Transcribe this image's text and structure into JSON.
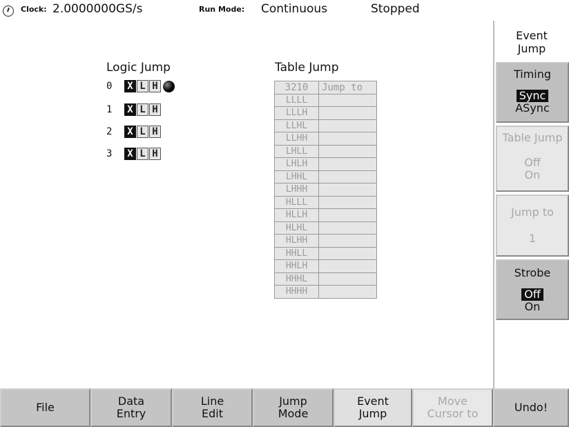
{
  "status": {
    "clock_icon": "clock-icon",
    "clock_label": "Clock:",
    "clock_value": "2.0000000GS/s",
    "run_mode_label": "Run Mode:",
    "run_mode_value": "Continuous",
    "state": "Stopped"
  },
  "logic_jump": {
    "title": "Logic Jump",
    "rows": [
      {
        "index": "0",
        "x": "X",
        "l": "L",
        "h": "H",
        "selected": "X"
      },
      {
        "index": "1",
        "x": "X",
        "l": "L",
        "h": "H",
        "selected": "X"
      },
      {
        "index": "2",
        "x": "X",
        "l": "L",
        "h": "H",
        "selected": "X"
      },
      {
        "index": "3",
        "x": "X",
        "l": "L",
        "h": "H",
        "selected": "X"
      }
    ]
  },
  "table_jump": {
    "title": "Table Jump",
    "header": [
      "3210",
      "Jump to"
    ],
    "rows": [
      "LLLL",
      "LLLH",
      "LLHL",
      "LLHH",
      "LHLL",
      "LHLH",
      "LHHL",
      "LHHH",
      "HLLL",
      "HLLH",
      "HLHL",
      "HLHH",
      "HHLL",
      "HHLH",
      "HHHL",
      "HHHH"
    ]
  },
  "side_menu": {
    "title_line1": "Event",
    "title_line2": "Jump",
    "timing": {
      "label": "Timing",
      "opt1": "Sync",
      "opt2": "ASync"
    },
    "table_jump": {
      "label": "Table Jump",
      "opt1": "Off",
      "opt2": "On"
    },
    "jump_to": {
      "label": "Jump to",
      "value": "1"
    },
    "strobe": {
      "label": "Strobe",
      "opt1": "Off",
      "opt2": "On"
    }
  },
  "bottom_menu": {
    "file": "File",
    "data_entry_1": "Data",
    "data_entry_2": "Entry",
    "line_edit_1": "Line",
    "line_edit_2": "Edit",
    "jump_mode_1": "Jump",
    "jump_mode_2": "Mode",
    "event_jump_1": "Event",
    "event_jump_2": "Jump",
    "move_cursor_1": "Move",
    "move_cursor_2": "Cursor to",
    "undo": "Undo!"
  }
}
